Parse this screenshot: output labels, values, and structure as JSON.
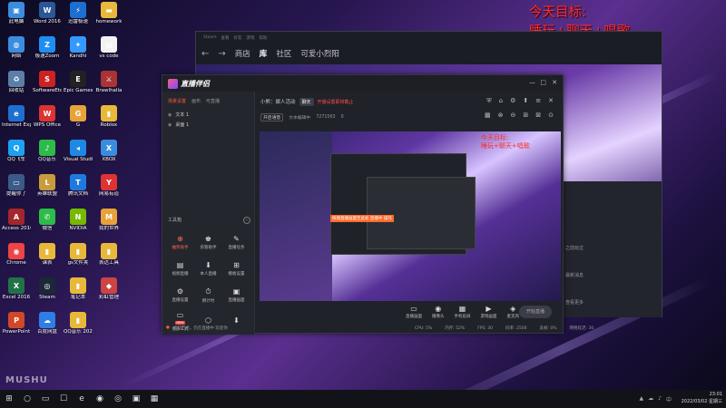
{
  "desktop": {
    "icons": [
      {
        "label": "此电脑",
        "glyph": "▣",
        "color": "#3a8dde"
      },
      {
        "label": "Word 2016",
        "glyph": "W",
        "color": "#2b5797"
      },
      {
        "label": "迅雷极速",
        "glyph": "⚡",
        "color": "#1c6fd1"
      },
      {
        "label": "homework",
        "glyph": "▬",
        "color": "#e8b83a"
      },
      {
        "label": "网络",
        "glyph": "◍",
        "color": "#3a8dde"
      },
      {
        "label": "极速Zoom",
        "glyph": "Z",
        "color": "#1f8ef1"
      },
      {
        "label": "Kandhi",
        "glyph": "✦",
        "color": "#3399ff"
      },
      {
        "label": "vs code",
        "glyph": "▤",
        "color": "#f2f2f2"
      },
      {
        "label": "回收站",
        "glyph": "♻",
        "color": "#5b7fa6"
      },
      {
        "label": "SoftwareEtc",
        "glyph": "S",
        "color": "#c22"
      },
      {
        "label": "Epic Games",
        "glyph": "E",
        "color": "#222"
      },
      {
        "label": "Brawlhalla",
        "glyph": "⚔",
        "color": "#a33"
      },
      {
        "label": "Internet Explorer",
        "glyph": "e",
        "color": "#1f6fd1"
      },
      {
        "label": "WPS Office",
        "glyph": "W",
        "color": "#d33"
      },
      {
        "label": "G",
        "glyph": "G",
        "color": "#e8a23a"
      },
      {
        "label": "Roblox",
        "glyph": "▮",
        "color": "#e8b83a"
      },
      {
        "label": "QQ飞车",
        "glyph": "Q",
        "color": "#1da1f2"
      },
      {
        "label": "QQ音乐",
        "glyph": "♪",
        "color": "#2dbb4a"
      },
      {
        "label": "Visual Studio Code",
        "glyph": "◂",
        "color": "#1e88e5"
      },
      {
        "label": "XBOX",
        "glyph": "X",
        "color": "#3a8dde"
      },
      {
        "label": "提醒你了",
        "glyph": "▭",
        "color": "#3a5a8a"
      },
      {
        "label": "英雄联盟",
        "glyph": "L",
        "color": "#c89b3c"
      },
      {
        "label": "腾讯文档",
        "glyph": "T",
        "color": "#1f7ae0"
      },
      {
        "label": "网易有道",
        "glyph": "Y",
        "color": "#d33"
      },
      {
        "label": "Access 2016",
        "glyph": "A",
        "color": "#a4262c"
      },
      {
        "label": "微信",
        "glyph": "✆",
        "color": "#2dbb4a"
      },
      {
        "label": "NVIDIA",
        "glyph": "N",
        "color": "#76b900"
      },
      {
        "label": "我的世界",
        "glyph": "M",
        "color": "#e8a23a"
      },
      {
        "label": "Chrome",
        "glyph": "◉",
        "color": "#e44"
      },
      {
        "label": "课表",
        "glyph": "▮",
        "color": "#e8b83a"
      },
      {
        "label": "gs文件夹",
        "glyph": "▮",
        "color": "#e8b83a"
      },
      {
        "label": "表达工具",
        "glyph": "▮",
        "color": "#e8b83a"
      },
      {
        "label": "Excel 2016",
        "glyph": "X",
        "color": "#217346"
      },
      {
        "label": "Steam",
        "glyph": "◎",
        "color": "#1b2838"
      },
      {
        "label": "笔记本",
        "glyph": "▮",
        "color": "#e8b83a"
      },
      {
        "label": "彩虹管理",
        "glyph": "◆",
        "color": "#c44"
      },
      {
        "label": "PowerPoint",
        "glyph": "P",
        "color": "#d24726"
      },
      {
        "label": "百度网盘",
        "glyph": "☁",
        "color": "#2f7ee6"
      },
      {
        "label": "QQ音乐 2021",
        "glyph": "▮",
        "color": "#e8b83a"
      },
      {
        "label": "",
        "glyph": "",
        "color": "transparent"
      }
    ]
  },
  "overlay": {
    "goal_line1": "今天目标:",
    "goal_line2": "睡玩+聊天+唱歌"
  },
  "steam": {
    "menu": [
      "Steam",
      "查看",
      "好友",
      "游戏",
      "帮助"
    ],
    "nav": [
      "商店",
      "库",
      "社区",
      "可爱小烈阳"
    ],
    "side_rows": [
      "之前玩过",
      "最新消息",
      "查看更多"
    ]
  },
  "app": {
    "logo": "直播伴侣",
    "window_controls": [
      "—",
      "□",
      "✕"
    ],
    "left_tabs": [
      "场景设置",
      "画布",
      "可直播"
    ],
    "scenes": [
      {
        "icon": "◉",
        "label": "文本 1"
      },
      {
        "icon": "◉",
        "label": "桌面 1"
      }
    ],
    "tools_title": "工具箱",
    "tools": [
      {
        "icon": "⊕",
        "label": "抽奖助手",
        "hot": true,
        "badge": ""
      },
      {
        "icon": "♚",
        "label": "房管助手",
        "hot": false,
        "badge": ""
      },
      {
        "icon": "✎",
        "label": "直播任务",
        "hot": false,
        "badge": ""
      },
      {
        "icon": "▤",
        "label": "视频直播",
        "hot": false,
        "badge": ""
      },
      {
        "icon": "⬇",
        "label": "本人直播",
        "hot": false,
        "badge": ""
      },
      {
        "icon": "⊞",
        "label": "模板设置",
        "hot": false,
        "badge": ""
      },
      {
        "icon": "⚙",
        "label": "直播设置",
        "hot": false,
        "badge": ""
      },
      {
        "icon": "⏱",
        "label": "倒计时",
        "hot": false,
        "badge": ""
      },
      {
        "icon": "▣",
        "label": "直播画面",
        "hot": false,
        "badge": ""
      },
      {
        "icon": "▭",
        "label": "更多工具",
        "hot": false,
        "badge": "NEW"
      },
      {
        "icon": "⬡",
        "label": "",
        "hot": false,
        "badge": ""
      },
      {
        "icon": "⬇",
        "label": "",
        "hot": false,
        "badge": ""
      }
    ],
    "left_status": "当前节点，仍在直播中 欢迎你",
    "main": {
      "title": "小熊：娱人活动",
      "tag": "聊天",
      "warning": "开播设置即将截止",
      "row2": [
        "开启语音",
        "文本编辑中",
        "7271563",
        "0"
      ],
      "top_icons": [
        "⛨",
        "⌂",
        "⚙",
        "⬆",
        "≡",
        "✕"
      ],
      "top_icons2": [
        "▦",
        "⊗",
        "⊖",
        "⊞",
        "⊠",
        "⊙"
      ]
    },
    "preview": {
      "red_text_1": "今天目标:",
      "red_text_2": "睡玩+聊天+唱歌",
      "orange_bar": "拖拽直播画面至此处   直播中 操作"
    },
    "bottom_buttons": [
      {
        "icon": "▭",
        "label": "直播画面",
        "red": false
      },
      {
        "icon": "◉",
        "label": "摄像头",
        "red": false
      },
      {
        "icon": "▦",
        "label": "手机投屏",
        "red": false
      },
      {
        "icon": "▶",
        "label": "游戏画面",
        "red": false
      },
      {
        "icon": "◈",
        "label": "麦克风",
        "red": false
      },
      {
        "icon": "◀)",
        "label": "扬声器",
        "red": true
      }
    ],
    "go_live": "开始直播",
    "status": [
      "CPU: 5%",
      "内存: 52%",
      "FPS: 30",
      "码率: 2500",
      "丢帧: 0%",
      "网络延迟: 30"
    ]
  },
  "taskbar": {
    "items": [
      "⊞",
      "○",
      "▭",
      "☐",
      "e",
      "◉",
      "◎",
      "▣",
      "▦"
    ],
    "tray": [
      "▲",
      "☁",
      "♪",
      "中"
    ],
    "time": "23:01",
    "date": "2022/03/02 星期三"
  },
  "watermark": "MUSHU"
}
